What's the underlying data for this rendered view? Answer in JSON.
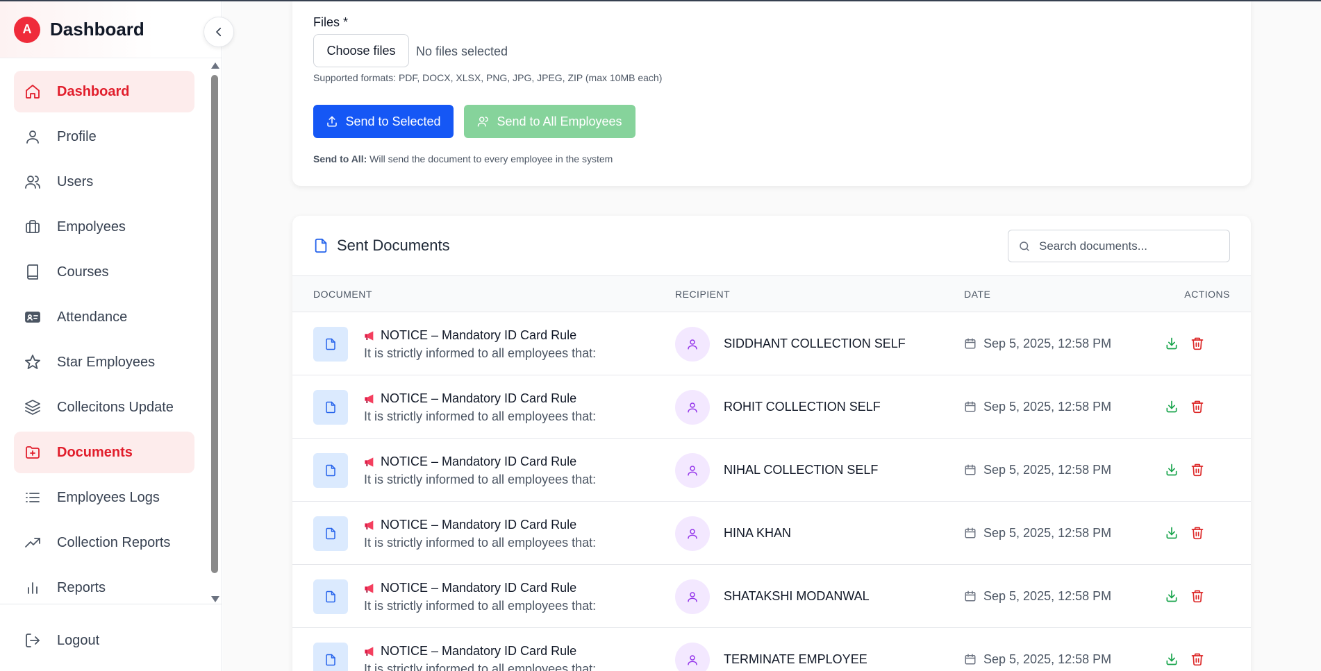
{
  "sidebar": {
    "logo_letter": "A",
    "title": "Dashboard",
    "items": [
      {
        "label": "Dashboard",
        "icon": "home-icon",
        "active": true
      },
      {
        "label": "Profile",
        "icon": "user-icon"
      },
      {
        "label": "Users",
        "icon": "users-icon"
      },
      {
        "label": "Empolyees",
        "icon": "briefcase-icon"
      },
      {
        "label": "Courses",
        "icon": "book-icon"
      },
      {
        "label": "Attendance",
        "icon": "id-card-icon"
      },
      {
        "label": "Star Employees",
        "icon": "star-icon"
      },
      {
        "label": "Collecitons Update",
        "icon": "layers-icon"
      },
      {
        "label": "Documents",
        "icon": "folder-plus-icon",
        "active": true
      },
      {
        "label": "Employees Logs",
        "icon": "list-icon"
      },
      {
        "label": "Collection Reports",
        "icon": "trending-up-icon"
      },
      {
        "label": "Reports",
        "icon": "bar-chart-icon"
      }
    ],
    "logout": "Logout"
  },
  "upload": {
    "files_label": "Files *",
    "choose_button": "Choose files",
    "no_files": "No files selected",
    "formats": "Supported formats: PDF, DOCX, XLSX, PNG, JPG, JPEG, ZIP (max 10MB each)",
    "send_selected": "Send to Selected",
    "send_all": "Send to All Employees",
    "note_bold": "Send to All:",
    "note_text": " Will send the document to every employee in the system"
  },
  "documents": {
    "title": "Sent Documents",
    "search_placeholder": "Search documents...",
    "columns": {
      "document": "DOCUMENT",
      "recipient": "RECIPIENT",
      "date": "DATE",
      "actions": "ACTIONS"
    },
    "rows": [
      {
        "title": "NOTICE – Mandatory ID Card Rule",
        "desc": "It is strictly informed to all employees that:",
        "recipient": "SIDDHANT COLLECTION SELF",
        "date": "Sep 5, 2025, 12:58 PM"
      },
      {
        "title": "NOTICE – Mandatory ID Card Rule",
        "desc": "It is strictly informed to all employees that:",
        "recipient": "ROHIT COLLECTION SELF",
        "date": "Sep 5, 2025, 12:58 PM"
      },
      {
        "title": "NOTICE – Mandatory ID Card Rule",
        "desc": "It is strictly informed to all employees that:",
        "recipient": "NIHAL COLLECTION SELF",
        "date": "Sep 5, 2025, 12:58 PM"
      },
      {
        "title": "NOTICE – Mandatory ID Card Rule",
        "desc": "It is strictly informed to all employees that:",
        "recipient": "HINA KHAN",
        "date": "Sep 5, 2025, 12:58 PM"
      },
      {
        "title": "NOTICE – Mandatory ID Card Rule",
        "desc": "It is strictly informed to all employees that:",
        "recipient": "SHATAKSHI MODANWAL",
        "date": "Sep 5, 2025, 12:58 PM"
      },
      {
        "title": "NOTICE – Mandatory ID Card Rule",
        "desc": "It is strictly informed to all employees that:",
        "recipient": "TERMINATE EMPLOYEE",
        "date": "Sep 5, 2025, 12:58 PM"
      }
    ]
  },
  "colors": {
    "accent_red": "#e11d2b",
    "primary_blue": "#1557f5",
    "success_green": "#16a34a",
    "muted_green": "#86d39b",
    "purple": "#9333ea"
  }
}
